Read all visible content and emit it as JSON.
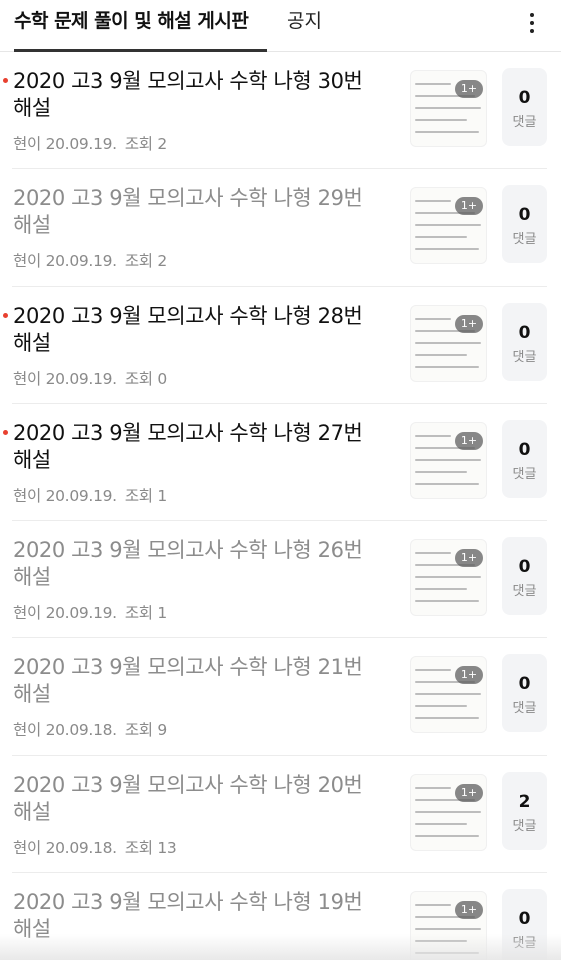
{
  "tabs": {
    "active_label": "수학 문제 풀이 및 해설 게시판",
    "notice_label": "공지"
  },
  "icons": {
    "more": "more-vertical-icon"
  },
  "colors": {
    "unread_dot": "#e8402f",
    "read_title": "#8c8c8c"
  },
  "posts": [
    {
      "title": "2020 고3 9월 모의고사 수학 나형 30번 해설",
      "author": "현이",
      "date": "20.09.19.",
      "views": "조회 2",
      "image_badge": "1+",
      "comment_count": "0",
      "comment_label": "댓글",
      "unread": true
    },
    {
      "title": "2020 고3 9월 모의고사 수학 나형 29번 해설",
      "author": "현이",
      "date": "20.09.19.",
      "views": "조회 2",
      "image_badge": "1+",
      "comment_count": "0",
      "comment_label": "댓글",
      "unread": false
    },
    {
      "title": "2020 고3 9월 모의고사 수학 나형 28번 해설",
      "author": "현이",
      "date": "20.09.19.",
      "views": "조회 0",
      "image_badge": "1+",
      "comment_count": "0",
      "comment_label": "댓글",
      "unread": true
    },
    {
      "title": "2020 고3 9월 모의고사 수학 나형 27번 해설",
      "author": "현이",
      "date": "20.09.19.",
      "views": "조회 1",
      "image_badge": "1+",
      "comment_count": "0",
      "comment_label": "댓글",
      "unread": true
    },
    {
      "title": "2020 고3 9월 모의고사 수학 나형 26번 해설",
      "author": "현이",
      "date": "20.09.19.",
      "views": "조회 1",
      "image_badge": "1+",
      "comment_count": "0",
      "comment_label": "댓글",
      "unread": false
    },
    {
      "title": "2020 고3 9월 모의고사 수학 나형 21번 해설",
      "author": "현이",
      "date": "20.09.18.",
      "views": "조회 9",
      "image_badge": "1+",
      "comment_count": "0",
      "comment_label": "댓글",
      "unread": false
    },
    {
      "title": "2020 고3 9월 모의고사 수학 나형 20번 해설",
      "author": "현이",
      "date": "20.09.18.",
      "views": "조회 13",
      "image_badge": "1+",
      "comment_count": "2",
      "comment_label": "댓글",
      "unread": false
    },
    {
      "title": "2020 고3 9월 모의고사 수학 나형 19번 해설",
      "author": "",
      "date": "",
      "views": "",
      "image_badge": "1+",
      "comment_count": "0",
      "comment_label": "댓글",
      "unread": false
    }
  ]
}
